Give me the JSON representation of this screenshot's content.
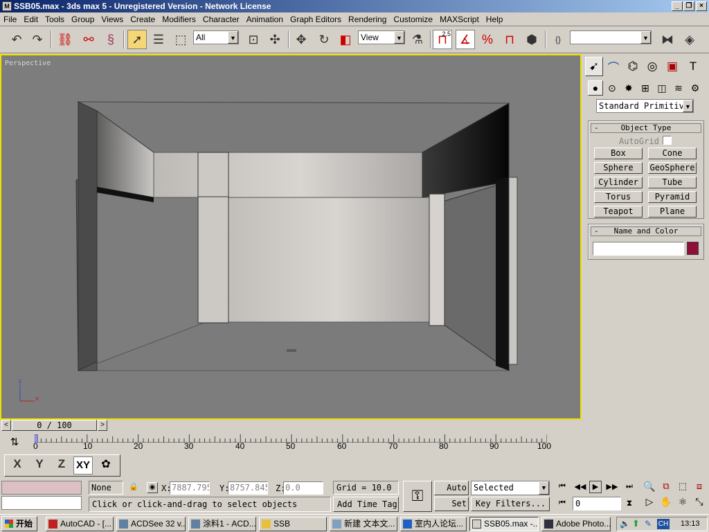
{
  "window": {
    "title": "SSB05.max - 3ds max 5 - Unregistered Version - Network License"
  },
  "menu": [
    "File",
    "Edit",
    "Tools",
    "Group",
    "Views",
    "Create",
    "Modifiers",
    "Character",
    "Animation",
    "Graph Editors",
    "Rendering",
    "Customize",
    "MAXScript",
    "Help"
  ],
  "toolbar": {
    "selection_filter": "All",
    "ref_coord": "View",
    "snap_value": "2.5",
    "named_sel": "",
    "icons": [
      "undo-icon",
      "redo-icon",
      "link-icon",
      "unlink-icon",
      "bind-spacewarp-icon",
      "select-icon",
      "select-by-name-icon",
      "rect-region-icon",
      "window-crossing-icon",
      "move-icon",
      "rotate-icon",
      "scale-icon",
      "use-pivot-icon",
      "manipulate-icon",
      "snap-icon",
      "angle-snap-icon",
      "percent-snap-icon",
      "spinner-snap-icon",
      "edit-named-sel-icon",
      "mirror-icon",
      "align-icon"
    ]
  },
  "viewport": {
    "label": "Perspective",
    "axis_x": "x",
    "axis_z": "z"
  },
  "command_panel": {
    "category_dropdown": "Standard Primitiv",
    "object_type_title": "Object Type",
    "autogrid_label": "AutoGrid",
    "primitives": [
      "Box",
      "Cone",
      "Sphere",
      "GeoSphere",
      "Cylinder",
      "Tube",
      "Torus",
      "Pyramid",
      "Teapot",
      "Plane"
    ],
    "name_color_title": "Name and Color",
    "name_value": "",
    "object_color": "#8e1038"
  },
  "timeslider": {
    "label": "0 / 100",
    "progress": 0
  },
  "timeline": {
    "ticks": [
      "0",
      "10",
      "20",
      "30",
      "40",
      "50",
      "60",
      "70",
      "80",
      "90",
      "100"
    ]
  },
  "axis_constraints": [
    "X",
    "Y",
    "Z",
    "XY"
  ],
  "status": {
    "selection": "None Se",
    "x_label": "X:",
    "x_value": "7887.795",
    "y_label": "Y:",
    "y_value": "8757.845",
    "z_label": "Z:",
    "z_value": "0.0",
    "grid": "Grid = 10.0",
    "prompt": "Click or click-and-drag to select objects",
    "add_time_tag": "Add Time Tag",
    "auto_key": "Auto Key",
    "set_key": "Set Key",
    "key_mode": "Selected",
    "key_filters": "Key Filters...",
    "frame": "0"
  },
  "taskbar": {
    "start": "开始",
    "tasks": [
      "AutoCAD - [...",
      "ACDSee 32 v...",
      "涂料1 - ACD...",
      "SSB",
      "新建 文本文...",
      "室内人论坛...",
      "SSB05.max -...",
      "Adobe Photo..."
    ],
    "tray_ime": "CH",
    "clock": "13:13"
  }
}
